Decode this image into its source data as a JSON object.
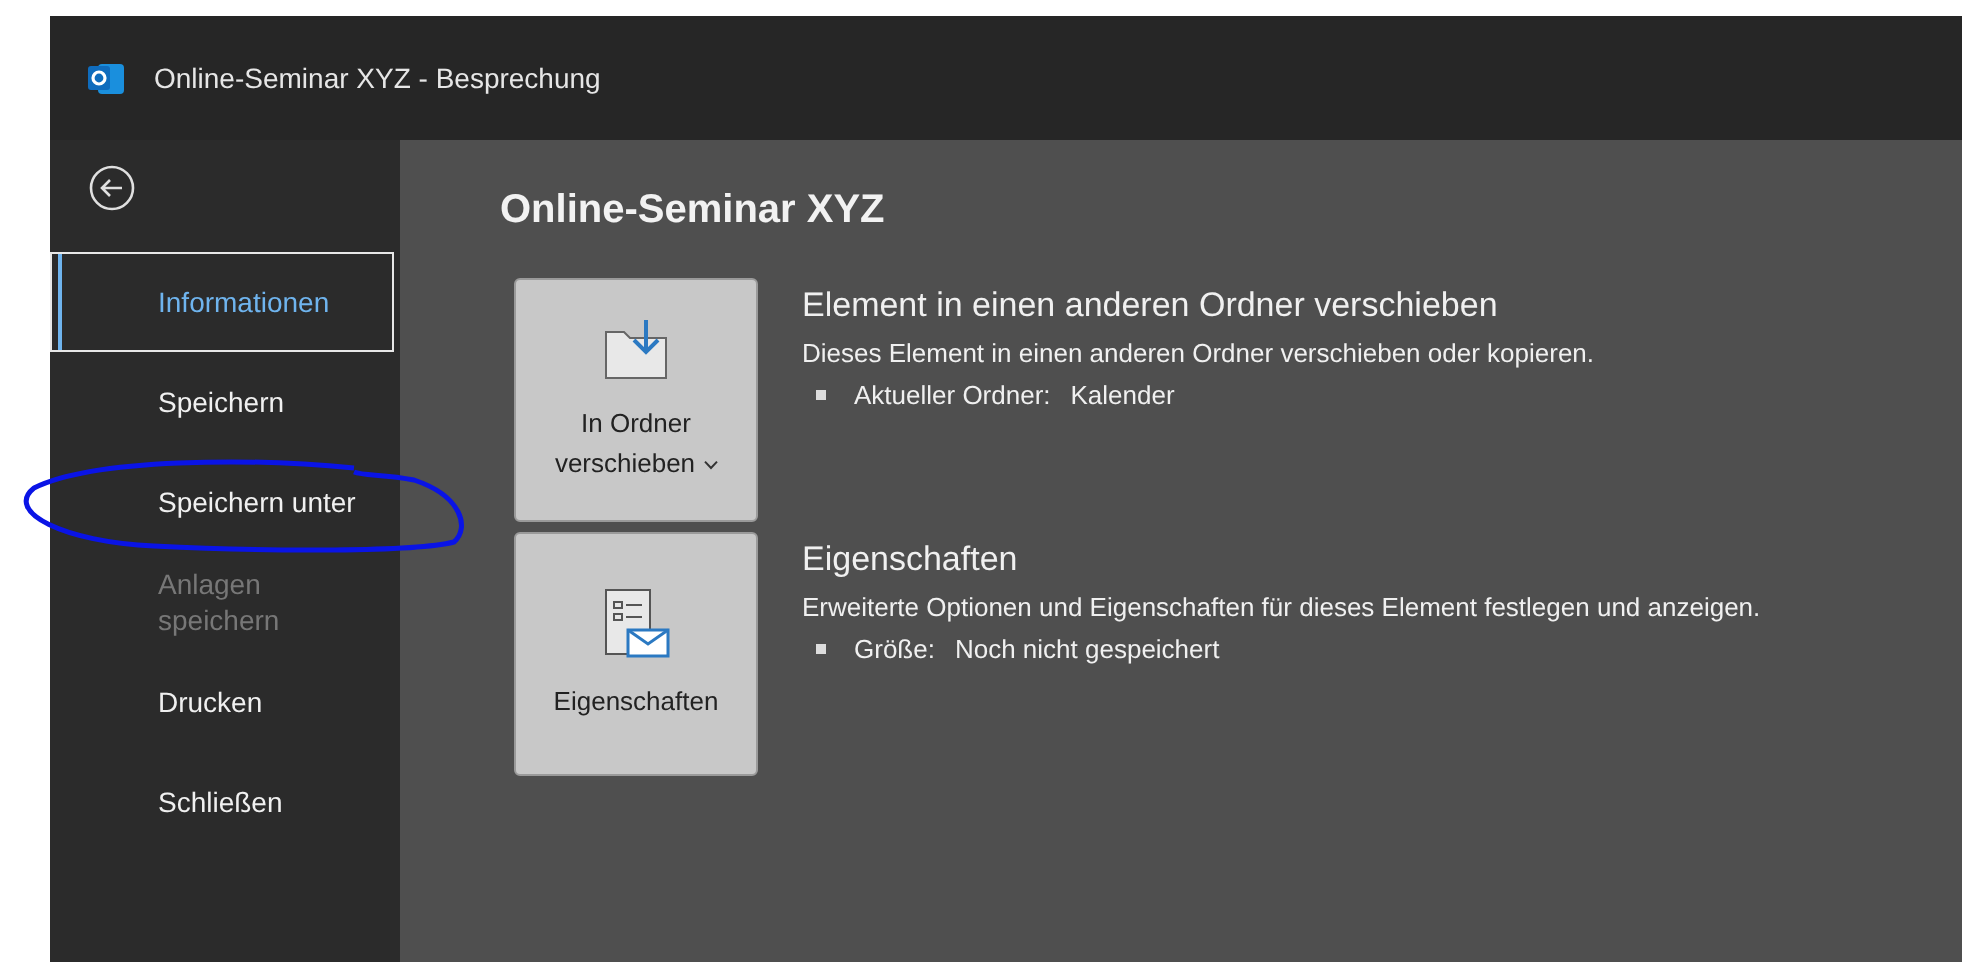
{
  "window": {
    "title": "Online-Seminar XYZ  -  Besprechung"
  },
  "sidebar": {
    "items": [
      {
        "label": "Informationen",
        "selected": true,
        "disabled": false
      },
      {
        "label": "Speichern",
        "selected": false,
        "disabled": false
      },
      {
        "label": "Speichern unter",
        "selected": false,
        "disabled": false
      },
      {
        "label": "Anlagen speichern",
        "selected": false,
        "disabled": true
      },
      {
        "label": "Drucken",
        "selected": false,
        "disabled": false
      },
      {
        "label": "Schließen",
        "selected": false,
        "disabled": false
      }
    ]
  },
  "page_title": "Online-Seminar XYZ",
  "sections": [
    {
      "kind": "move",
      "button": "In Ordner verschieben",
      "heading": "Element in einen anderen Ordner verschieben",
      "description": "Dieses Element in einen anderen Ordner verschieben oder kopieren.",
      "detail_label": "Aktueller Ordner:",
      "detail_value": "Kalender"
    },
    {
      "kind": "properties",
      "button": "Eigenschaften",
      "heading": "Eigenschaften",
      "description": "Erweiterte Optionen und Eigenschaften für dieses Element festlegen und anzeigen.",
      "detail_label": "Größe:",
      "detail_value": "Noch nicht gespeichert"
    }
  ]
}
